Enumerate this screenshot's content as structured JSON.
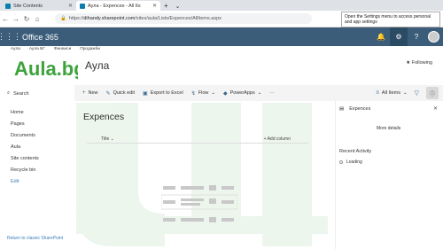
{
  "browser": {
    "tabs": [
      {
        "label": "Site Contents",
        "active": false
      },
      {
        "label": "Аула - Expences - All Its",
        "active": true
      }
    ],
    "new_tab": "+",
    "url_prefix": "https://",
    "url_host": "dihandy.sharepoint.com",
    "url_path": "/sites/aula/Lists/Expences/AllItems.aspx",
    "tooltip": "Open the Settings menu to access personal and app settings"
  },
  "suite": {
    "app_name": "Office 365"
  },
  "topnav": {
    "items": [
      "Аула",
      "Аула БГ",
      "Финанси",
      "Продажби"
    ]
  },
  "site": {
    "logo_text": "Aula.bg",
    "title": "Аула",
    "follow_label": "Following"
  },
  "leftnav": {
    "search_placeholder": "Search",
    "items": [
      "Home",
      "Pages",
      "Documents",
      "Aula",
      "Site contents",
      "Recycle bin"
    ],
    "edit_label": "Edit",
    "return_label": "Return to classic SharePoint"
  },
  "commandbar": {
    "new": "New",
    "quick_edit": "Quick edit",
    "export": "Export to Excel",
    "flow": "Flow",
    "powerapps": "PowerApps",
    "more": "···",
    "view": "All Items"
  },
  "list": {
    "title": "Expences",
    "column_title": "Title",
    "add_column": "+ Add column"
  },
  "pane": {
    "title": "Expences",
    "more_details": "More details",
    "recent_activity": "Recent Activity",
    "loading": "Loading"
  },
  "colors": {
    "suite_bar": "#3b5d7a",
    "accent": "#3b7db8",
    "logo_green": "#3da33d"
  }
}
